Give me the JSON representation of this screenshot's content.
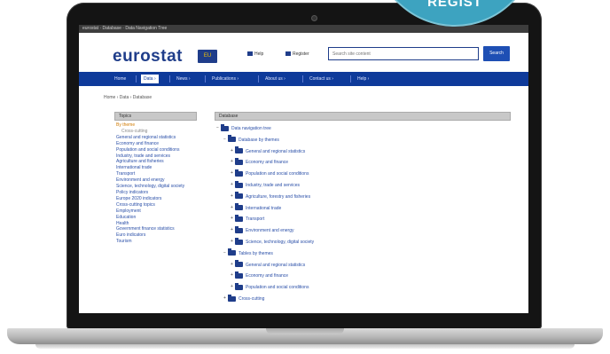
{
  "badge": {
    "text": "REGIST"
  },
  "browser": {
    "tab_text": "eurostat · Database · Data Navigation Tree"
  },
  "header": {
    "logo_text": "eurostat",
    "logo_flag_text": "EU",
    "help_link": "Help",
    "register_link": "Register",
    "search_placeholder": "Search site content",
    "search_button": "Search"
  },
  "nav": {
    "items": [
      {
        "label": "Home"
      },
      {
        "label": "Data  ›",
        "active": true
      },
      {
        "label": "News  ›"
      },
      {
        "label": "Publications  ›"
      },
      {
        "label": "About us  ›"
      },
      {
        "label": "Contact us  ›"
      },
      {
        "label": "Help  ›"
      }
    ]
  },
  "breadcrumb": "Home  ›  Data  ›  Database",
  "left_panel": {
    "title": "Topics",
    "items": [
      {
        "label": "By theme",
        "kind": "current"
      },
      {
        "label": "Cross-cutting",
        "kind": "sub"
      },
      {
        "label": "General and regional statistics"
      },
      {
        "label": "Economy and finance"
      },
      {
        "label": "Population and social conditions"
      },
      {
        "label": "Industry, trade and services"
      },
      {
        "label": "Agriculture and fisheries"
      },
      {
        "label": "International trade"
      },
      {
        "label": "Transport"
      },
      {
        "label": "Environment and energy"
      },
      {
        "label": "Science, technology, digital society"
      },
      {
        "label": "Policy indicators"
      },
      {
        "label": "Europe 2020 indicators"
      },
      {
        "label": "Cross-cutting topics"
      },
      {
        "label": "Employment"
      },
      {
        "label": "Education"
      },
      {
        "label": "Health"
      },
      {
        "label": "Government finance statistics"
      },
      {
        "label": "Euro indicators"
      },
      {
        "label": "Tourism"
      }
    ]
  },
  "right_panel": {
    "title": "Database",
    "tree": [
      {
        "label": "Data navigation tree",
        "level": 0,
        "toggle": "−"
      },
      {
        "label": "Database by themes",
        "level": 1,
        "toggle": "−"
      },
      {
        "label": "General and regional statistics",
        "level": 2,
        "toggle": "+"
      },
      {
        "label": "Economy and finance",
        "level": 2,
        "toggle": "+"
      },
      {
        "label": "Population and social conditions",
        "level": 2,
        "toggle": "+"
      },
      {
        "label": "Industry, trade and services",
        "level": 2,
        "toggle": "+"
      },
      {
        "label": "Agriculture, forestry and fisheries",
        "level": 2,
        "toggle": "+"
      },
      {
        "label": "International trade",
        "level": 2,
        "toggle": "+"
      },
      {
        "label": "Transport",
        "level": 2,
        "toggle": "+"
      },
      {
        "label": "Environment and energy",
        "level": 2,
        "toggle": "+"
      },
      {
        "label": "Science, technology, digital society",
        "level": 2,
        "toggle": "+"
      },
      {
        "label": "Tables by themes",
        "level": 1,
        "toggle": "−"
      },
      {
        "label": "General and regional statistics",
        "level": 2,
        "toggle": "+"
      },
      {
        "label": "Economy and finance",
        "level": 2,
        "toggle": "+"
      },
      {
        "label": "Population and social conditions",
        "level": 2,
        "toggle": "+"
      },
      {
        "label": "Cross-cutting",
        "level": 1,
        "toggle": "+"
      }
    ]
  }
}
